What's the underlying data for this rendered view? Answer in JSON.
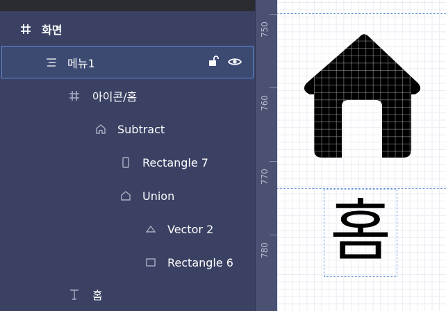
{
  "layers": [
    {
      "label": "화면",
      "icon": "frame-hash-icon",
      "bold": true
    },
    {
      "label": "메뉴1",
      "icon": "auto-layout-icon",
      "selected": true,
      "lock_icon": "unlock-icon",
      "eye_icon": "eye-icon"
    },
    {
      "label": "아이콘/홈",
      "icon": "frame-hash-icon"
    },
    {
      "label": "Subtract",
      "icon": "house-outline-icon"
    },
    {
      "label": "Rectangle 7",
      "icon": "rectangle-vertical-icon"
    },
    {
      "label": "Union",
      "icon": "pentagon-icon"
    },
    {
      "label": "Vector 2",
      "icon": "triangle-icon"
    },
    {
      "label": "Rectangle 6",
      "icon": "rectangle-icon"
    },
    {
      "label": "홈",
      "icon": "text-icon"
    }
  ],
  "ruler": {
    "labels": [
      "750",
      "760",
      "770",
      "780"
    ]
  },
  "canvas": {
    "text_glyph": "홈",
    "shape_icon": "home-icon"
  },
  "colors": {
    "panel_bg": "#3a4163",
    "selection_border": "#5b8bd8",
    "canvas_bg": "#ffffff",
    "ruler_bg": "#4a5172"
  }
}
